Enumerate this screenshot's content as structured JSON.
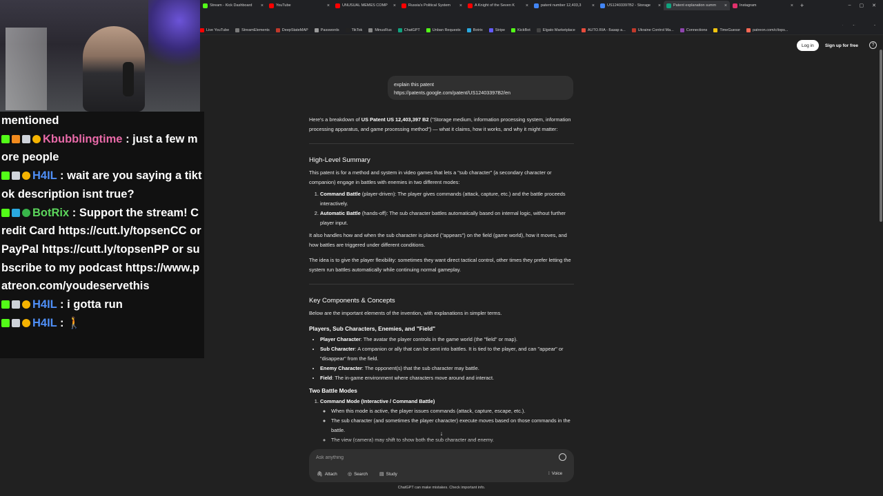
{
  "browser": {
    "tabs": [
      {
        "title": "Stream - Kick Dashboard",
        "color": "#53fc18"
      },
      {
        "title": "YouTube",
        "color": "#ff0000"
      },
      {
        "title": "UNUSUAL MEMES COMP",
        "color": "#ff0000"
      },
      {
        "title": "Russia's Political System",
        "color": "#ff0000"
      },
      {
        "title": "A Knight of the Seven K",
        "color": "#ff0000"
      },
      {
        "title": "patent number 12,403,3",
        "color": "#4285f4"
      },
      {
        "title": "US12403397B2 - Storage",
        "color": "#4285f4"
      },
      {
        "title": "Patent explanation summ",
        "color": "#10a37f",
        "active": true
      },
      {
        "title": "Instagram",
        "color": "#e1306c"
      }
    ],
    "bookmarks": [
      {
        "label": "Live YouTube",
        "color": "#ff0000"
      },
      {
        "label": "StreamElements",
        "color": "#7a7a7a"
      },
      {
        "label": "DeepStateMAP",
        "color": "#c0392b"
      },
      {
        "label": "Passwords",
        "color": "#9a9a9a"
      },
      {
        "label": "TikTok",
        "color": "#222222"
      },
      {
        "label": "MinusRus",
        "color": "#888888"
      },
      {
        "label": "ChatGPT",
        "color": "#10a37f"
      },
      {
        "label": "Unban Requests",
        "color": "#53fc18"
      },
      {
        "label": "Botrix",
        "color": "#2aa9e0"
      },
      {
        "label": "Stripe",
        "color": "#635bff"
      },
      {
        "label": "KickBot",
        "color": "#53fc18"
      },
      {
        "label": "Elgato Marketplace",
        "color": "#444444"
      },
      {
        "label": "AUTO.RIA - Базар а...",
        "color": "#e74c3c"
      },
      {
        "label": "Ukraine Control Ma...",
        "color": "#c0392b"
      },
      {
        "label": "Connections",
        "color": "#8e44ad"
      },
      {
        "label": "TimeGuessr",
        "color": "#f1c40f"
      },
      {
        "label": "patreon.com/c/tops...",
        "color": "#f96854"
      }
    ]
  },
  "chat": {
    "lines": [
      {
        "badges": [],
        "name": "",
        "name_color": "#ffffff",
        "text": "mentioned"
      },
      {
        "badges": [
          "kick",
          "box",
          "hammer",
          "gold"
        ],
        "name": "Kbubblingtime",
        "name_color": "#e86aa8",
        "text": " : just a few more people"
      },
      {
        "badges": [
          "kick",
          "hammer",
          "gold"
        ],
        "name": "H4IL",
        "name_color": "#4f8ff7",
        "text": " : wait are you saying a tiktok description isnt true?"
      },
      {
        "badges": [
          "kick",
          "bot",
          "check"
        ],
        "name": "BotRix",
        "name_color": "#5cd65c",
        "text": " : Support the stream! Credit Card https://cutt.ly/topsenCC or PayPal https://cutt.ly/topsenPP or subscribe to my podcast https://www.patreon.com/youdeservethis"
      },
      {
        "badges": [
          "kick",
          "hammer",
          "gold"
        ],
        "name": "H4IL",
        "name_color": "#4f8ff7",
        "text": " : i gotta run"
      },
      {
        "badges": [
          "kick",
          "hammer",
          "gold"
        ],
        "name": "H4IL",
        "name_color": "#4f8ff7",
        "text": " : 🚶"
      }
    ]
  },
  "header": {
    "login": "Log in",
    "signup": "Sign up for free",
    "help": "?"
  },
  "user_message": {
    "line1": "explain this patent",
    "line2": "https://patents.google.com/patent/US12403397B2/en"
  },
  "answer": {
    "intro_pre": "Here's a breakdown of ",
    "intro_bold": "US Patent US 12,403,397 B2",
    "intro_post": " (\"Storage medium, information processing system, information processing apparatus, and game processing method\") — what it claims, how it works, and why it might matter:",
    "summary_heading": "High-Level Summary",
    "summary_p1": "This patent is for a method and system in video games that lets a \"sub character\" (a secondary character or companion) engage in battles with enemies in two different modes:",
    "modes": [
      {
        "bold": "Command Battle",
        "text": " (player-driven): The player gives commands (attack, capture, etc.) and the battle proceeds interactively."
      },
      {
        "bold": "Automatic Battle",
        "text": " (hands-off): The sub character battles automatically based on internal logic, without further player input."
      }
    ],
    "summary_p2": "It also handles how and when the sub character is placed (\"appears\") on the field (game world), how it moves, and how battles are triggered under different conditions.",
    "summary_p3": "The idea is to give the player flexibility: sometimes they want direct tactical control, other times they prefer letting the system run battles automatically while continuing normal gameplay.",
    "components_heading": "Key Components & Concepts",
    "components_intro": "Below are the important elements of the invention, with explanations in simpler terms.",
    "players_heading": "Players, Sub Characters, Enemies, and \"Field\"",
    "players": [
      {
        "bold": "Player Character",
        "text": ": The avatar the player controls in the game world (the \"field\" or map)."
      },
      {
        "bold": "Sub Character",
        "text": ": A companion or ally that can be sent into battles. It is tied to the player, and can \"appear\" or \"disappear\" from the field."
      },
      {
        "bold": "Enemy Character",
        "text": ": The opponent(s) that the sub character may battle."
      },
      {
        "bold": "Field",
        "text": ": The in-game environment where characters move around and interact."
      }
    ],
    "modes_heading": "Two Battle Modes",
    "mode1_title": "Command Mode (Interactive / Command Battle)",
    "mode1_points": [
      "When this mode is active, the player issues commands (attack, capture, escape, etc.).",
      "The sub character (and sometimes the player character) execute moves based on those commands in the battle.",
      "The view (camera) may shift to show both the sub character and enemy."
    ]
  },
  "composer": {
    "placeholder": "Ask anything",
    "attach": "Attach",
    "search": "Search",
    "study": "Study",
    "voice": "Voice"
  },
  "disclaimer": "ChatGPT can make mistakes. Check important info."
}
